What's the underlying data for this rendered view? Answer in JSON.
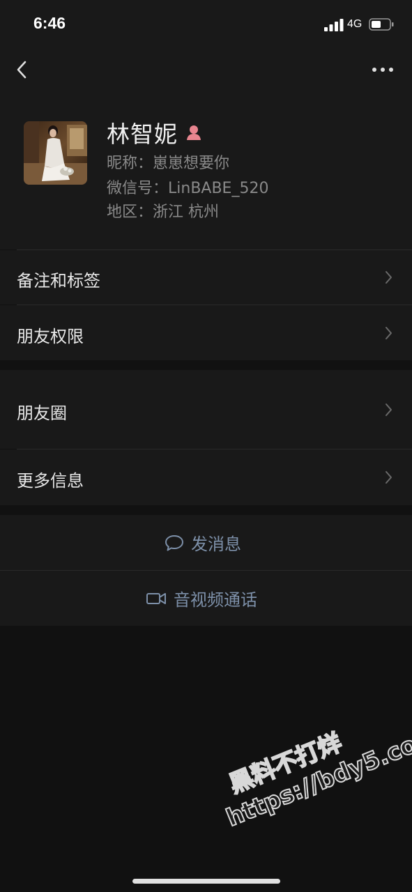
{
  "status_bar": {
    "time": "6:46",
    "network": "4G",
    "signal_icon": "signal-bars-icon",
    "battery_icon": "battery-icon"
  },
  "nav": {
    "back_icon": "chevron-left-icon",
    "more_icon": "ellipsis-icon"
  },
  "profile": {
    "name": "林智妮",
    "gender_icon": "female-icon",
    "nickname": "昵称：崽崽想要你",
    "wechat_id": "微信号：LinBABE_520",
    "region": "地区：浙江 杭州"
  },
  "menu": [
    {
      "label": "备注和标签"
    },
    {
      "label": "朋友权限"
    },
    {
      "label": "朋友圈"
    },
    {
      "label": "更多信息"
    }
  ],
  "actions": {
    "message": {
      "label": "发消息",
      "icon": "chat-bubble-icon"
    },
    "video_call": {
      "label": "音视频通话",
      "icon": "video-camera-icon"
    }
  },
  "watermark": {
    "line1": "黑料不打烊",
    "line2": "https://bdy5.co"
  },
  "colors": {
    "background": "#111111",
    "card": "#191919",
    "action_text": "#7d90a9",
    "secondary_text": "#8a8a8a",
    "gender_female": "#e8858f"
  }
}
